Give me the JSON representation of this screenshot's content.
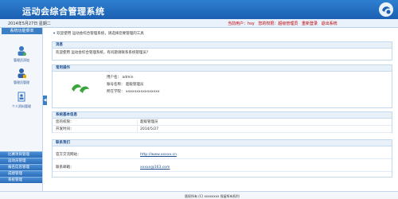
{
  "header": {
    "title": "运动会综合管理系统",
    "logo_icon": "logo-icon"
  },
  "infobar": {
    "date": "2014年5月27日 星期二",
    "user_label": "当前用户：",
    "user_name": "hsy",
    "greeting": "您的权限：超级管理员",
    "logout_text": "重新登录",
    "exit_text": "退出系统"
  },
  "sidebar": {
    "title": "系统功能菜单",
    "items": [
      {
        "label": "管理员添加",
        "icon": "admin-add-icon"
      },
      {
        "label": "管理员管理",
        "icon": "admin-manage-icon"
      },
      {
        "label": "个人资料管理",
        "icon": "profile-icon"
      }
    ],
    "bottom_items": [
      {
        "label": "比赛项目管理"
      },
      {
        "label": "运动员管理"
      },
      {
        "label": "报名信息管理"
      },
      {
        "label": "成绩管理"
      },
      {
        "label": "系统管理"
      }
    ]
  },
  "main": {
    "welcome": "欢迎使用  运动会综合管理系统，请选择您要管理的工具",
    "info_panel": {
      "title": "消息",
      "text": "欢迎使用 运动会综合管理系统，有问题请联系系统管理员？"
    },
    "user_panel": {
      "title": "常用操作",
      "rows": [
        {
          "k": "用户名：",
          "v": "admin"
        },
        {
          "k": "账号名称：",
          "v": "超级管理员"
        },
        {
          "k": "所在学院：",
          "v": "xxxxxxxxxxxxxxxx"
        }
      ]
    },
    "sys_panel": {
      "title": "系统基本信息",
      "rows": [
        {
          "k": "您的权限：",
          "v": "超级管理员"
        },
        {
          "k": "开发时间：",
          "v": "2014/5/27"
        }
      ]
    },
    "contact_panel": {
      "title": "联系我们",
      "rows": [
        {
          "k": "官方交流网站：",
          "v": "http://www.xxxxx.cn"
        },
        {
          "k": "联系邮箱：",
          "v": "xxxxx@163.com"
        }
      ]
    }
  },
  "footer": {
    "copyright": "版权所有 (C) xxxxxxxx  保留所有权利"
  }
}
